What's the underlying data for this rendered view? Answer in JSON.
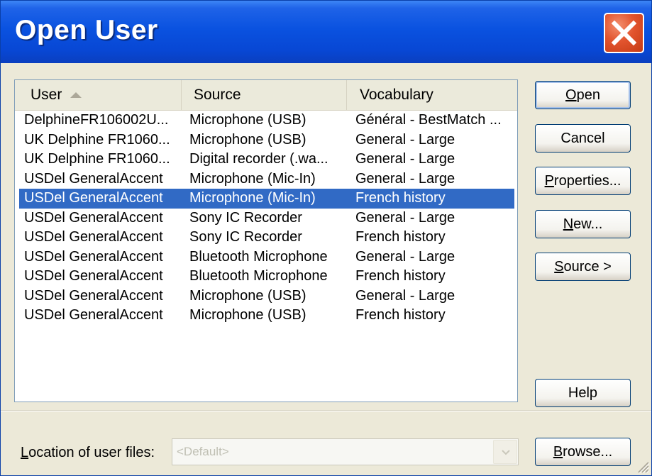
{
  "dialog": {
    "title": "Open User"
  },
  "list": {
    "columns": [
      "User",
      "Source",
      "Vocabulary"
    ],
    "rows": [
      {
        "user": "DelphineFR106002U...",
        "source": "Microphone (USB)",
        "vocabulary": "Général - BestMatch ..."
      },
      {
        "user": "UK Delphine FR1060...",
        "source": "Microphone (USB)",
        "vocabulary": "General - Large"
      },
      {
        "user": "UK Delphine FR1060...",
        "source": "Digital recorder (.wa...",
        "vocabulary": "General - Large"
      },
      {
        "user": "USDel GeneralAccent",
        "source": "Microphone (Mic-In)",
        "vocabulary": "General - Large"
      },
      {
        "user": "USDel GeneralAccent",
        "source": "Microphone (Mic-In)",
        "vocabulary": "French history",
        "selected": true
      },
      {
        "user": "USDel GeneralAccent",
        "source": "Sony IC Recorder",
        "vocabulary": "General - Large"
      },
      {
        "user": "USDel GeneralAccent",
        "source": "Sony IC Recorder",
        "vocabulary": "French history"
      },
      {
        "user": "USDel GeneralAccent",
        "source": "Bluetooth Microphone",
        "vocabulary": "General - Large"
      },
      {
        "user": "USDel GeneralAccent",
        "source": "Bluetooth Microphone",
        "vocabulary": "French history"
      },
      {
        "user": "USDel GeneralAccent",
        "source": "Microphone (USB)",
        "vocabulary": "General - Large"
      },
      {
        "user": "USDel GeneralAccent",
        "source": "Microphone (USB)",
        "vocabulary": "French history"
      }
    ]
  },
  "buttons": {
    "open": {
      "mnemonic": "O",
      "rest": "pen"
    },
    "cancel": "Cancel",
    "properties": {
      "mnemonic": "P",
      "rest": "roperties..."
    },
    "new": {
      "mnemonic": "N",
      "rest": "ew..."
    },
    "source": {
      "mnemonic": "S",
      "rest": "ource >"
    },
    "help": "Help",
    "browse": {
      "mnemonic": "B",
      "rest": "rowse..."
    }
  },
  "location": {
    "label_mnemonic": "L",
    "label_rest": "ocation of user files:",
    "value": "<Default>"
  },
  "colors": {
    "titlebar": "#0a52e0",
    "selection": "#316ac5",
    "dialog_bg": "#ece9d8",
    "close_button": "#e2542e"
  }
}
